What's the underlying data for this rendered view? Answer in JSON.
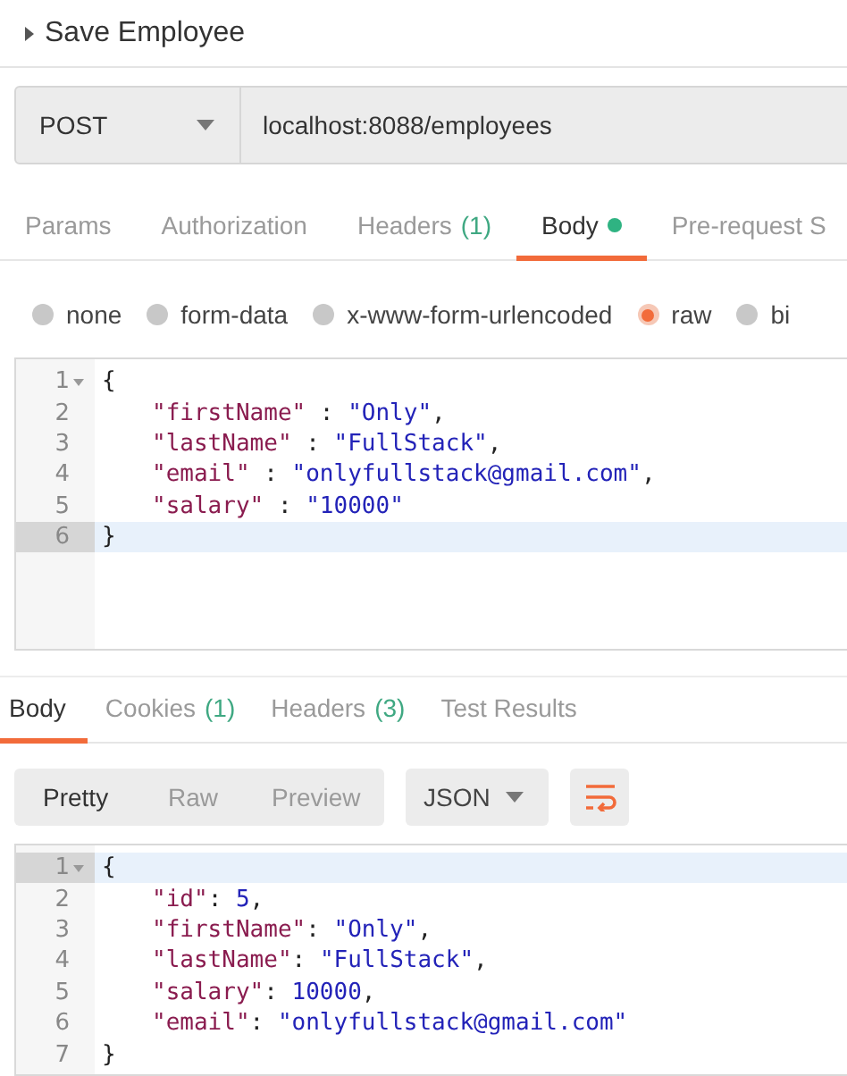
{
  "request": {
    "title": "Save Employee",
    "method": "POST",
    "url": "localhost:8088/employees"
  },
  "request_tabs": [
    {
      "label": "Params",
      "selected": false,
      "dot": false
    },
    {
      "label": "Authorization",
      "selected": false,
      "dot": false
    },
    {
      "label": "Headers",
      "count": "(1)",
      "selected": false,
      "dot": false
    },
    {
      "label": "Body",
      "selected": true,
      "dot": true
    },
    {
      "label": "Pre-request S",
      "selected": false,
      "dot": false
    }
  ],
  "body_types": [
    {
      "label": "none",
      "selected": false
    },
    {
      "label": "form-data",
      "selected": false
    },
    {
      "label": "x-www-form-urlencoded",
      "selected": false
    },
    {
      "label": "raw",
      "selected": true
    },
    {
      "label": "bi",
      "selected": false
    }
  ],
  "request_body": [
    {
      "number": "1",
      "brace": "{",
      "foldable": true,
      "active": false
    },
    {
      "number": "2",
      "key": "\"firstName\"",
      "sep": " : ",
      "value": "\"Only\"",
      "trail": ",",
      "active": false
    },
    {
      "number": "3",
      "key": "\"lastName\"",
      "sep": " : ",
      "value": "\"FullStack\"",
      "trail": ",",
      "active": false
    },
    {
      "number": "4",
      "key": "\"email\"",
      "sep": " : ",
      "value": "\"onlyfullstack@gmail.com\"",
      "trail": ",",
      "active": false
    },
    {
      "number": "5",
      "key": "\"salary\"",
      "sep": " : ",
      "value": "\"10000\"",
      "active": false
    },
    {
      "number": "6",
      "brace": "}",
      "active": true
    }
  ],
  "response_tabs": [
    {
      "label": "Body",
      "selected": true
    },
    {
      "label": "Cookies",
      "count": "(1)",
      "selected": false
    },
    {
      "label": "Headers",
      "count": "(3)",
      "selected": false
    },
    {
      "label": "Test Results",
      "selected": false
    }
  ],
  "view_modes": [
    {
      "label": "Pretty",
      "selected": true
    },
    {
      "label": "Raw",
      "selected": false
    },
    {
      "label": "Preview",
      "selected": false
    }
  ],
  "format": "JSON",
  "response_body": [
    {
      "number": "1",
      "brace": "{",
      "foldable": true,
      "active": true
    },
    {
      "number": "2",
      "key": "\"id\"",
      "sep": ": ",
      "value": "5",
      "trail": ",",
      "active": false
    },
    {
      "number": "3",
      "key": "\"firstName\"",
      "sep": ": ",
      "value": "\"Only\"",
      "trail": ",",
      "active": false
    },
    {
      "number": "4",
      "key": "\"lastName\"",
      "sep": ": ",
      "value": "\"FullStack\"",
      "trail": ",",
      "active": false
    },
    {
      "number": "5",
      "key": "\"salary\"",
      "sep": ": ",
      "value": "10000",
      "trail": ",",
      "active": false
    },
    {
      "number": "6",
      "key": "\"email\"",
      "sep": ": ",
      "value": "\"onlyfullstack@gmail.com\"",
      "active": false
    },
    {
      "number": "7",
      "brace": "}",
      "active": false
    }
  ]
}
